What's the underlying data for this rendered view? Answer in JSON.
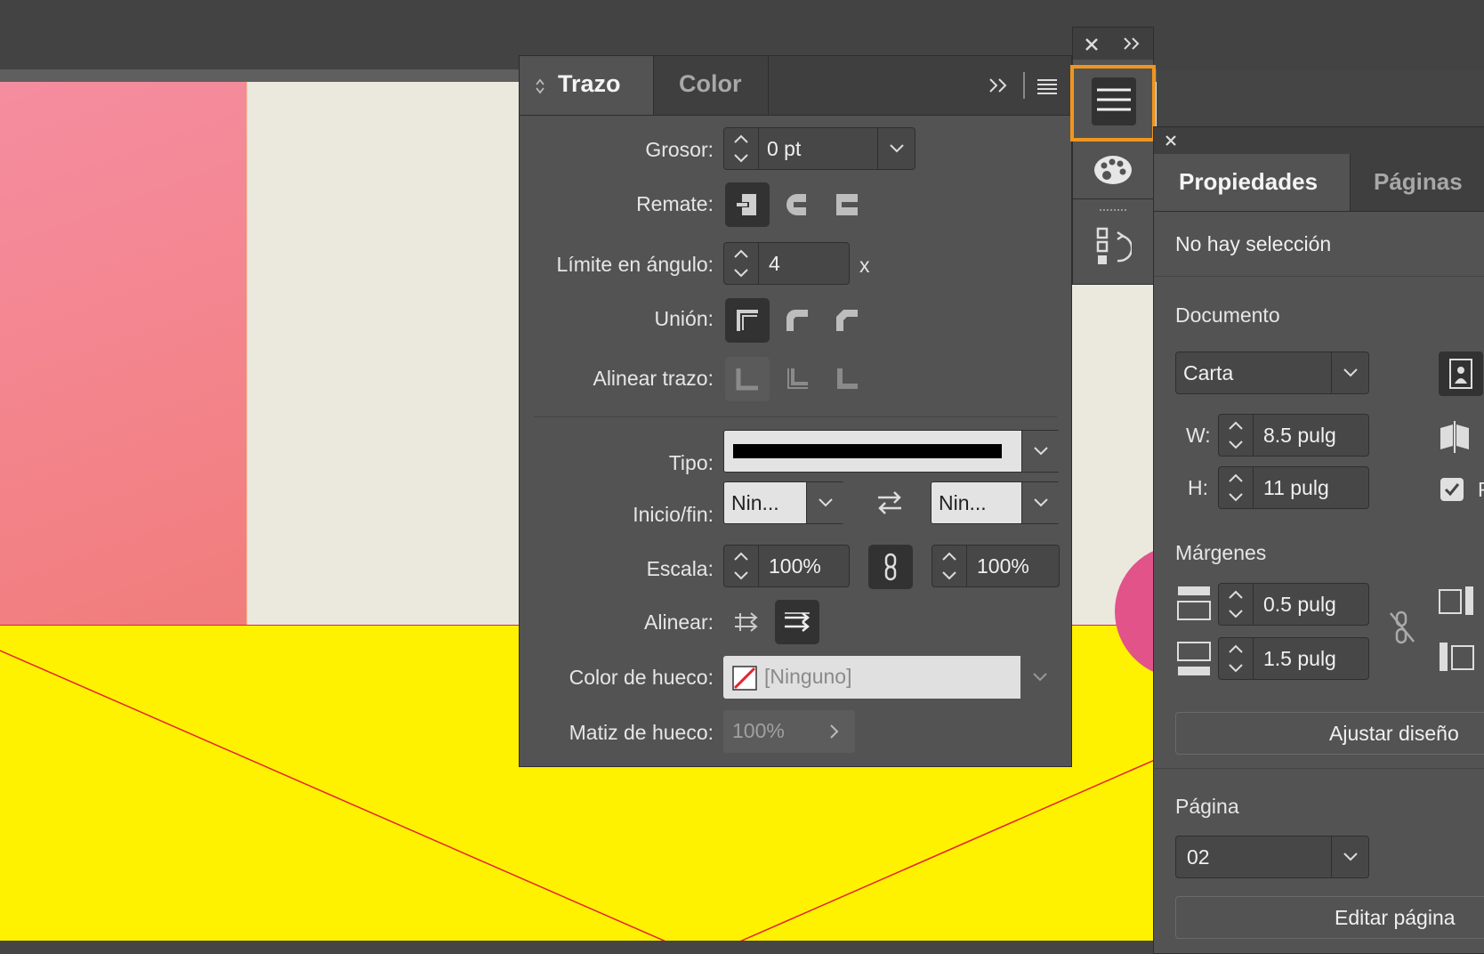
{
  "stroke_panel": {
    "tabs": [
      "Trazo",
      "Color"
    ],
    "active_tab": "Trazo",
    "weight": {
      "label": "Grosor:",
      "value": "0 pt"
    },
    "cap": {
      "label": "Remate:"
    },
    "miter": {
      "label": "Límite en ángulo:",
      "value": "4",
      "suffix": "x"
    },
    "join": {
      "label": "Unión:"
    },
    "align_stroke": {
      "label": "Alinear trazo:"
    },
    "type": {
      "label": "Tipo:"
    },
    "start_end": {
      "label": "Inicio/fin:",
      "start": "Nin...",
      "end": "Nin..."
    },
    "scale": {
      "label": "Escala:",
      "start": "100%",
      "end": "100%"
    },
    "align": {
      "label": "Alinear:"
    },
    "gap_color": {
      "label": "Color de hueco:",
      "value": "[Ninguno]"
    },
    "gap_tint": {
      "label": "Matiz de hueco:",
      "value": "100%"
    }
  },
  "properties_panel": {
    "tabs": [
      "Propiedades",
      "Páginas"
    ],
    "active_tab": "Propiedades",
    "status": "No hay selección",
    "document": {
      "title": "Documento",
      "preset": "Carta",
      "w_label": "W:",
      "w_value": "8.5 pulg",
      "h_label": "H:",
      "h_value": "11 pulg",
      "checkbox_label_partial": "F"
    },
    "margins": {
      "title": "Márgenes",
      "top": "0.5 pulg",
      "bottom": "1.5 pulg"
    },
    "adjust_button": "Ajustar diseño",
    "page": {
      "title": "Página",
      "value": "02",
      "edit_button": "Editar página"
    }
  },
  "colors": {
    "accent_highlight": "#f0961e",
    "canvas_pink": "#f58da0",
    "canvas_yellow": "#fff200",
    "guide_red": "#e6232b"
  }
}
